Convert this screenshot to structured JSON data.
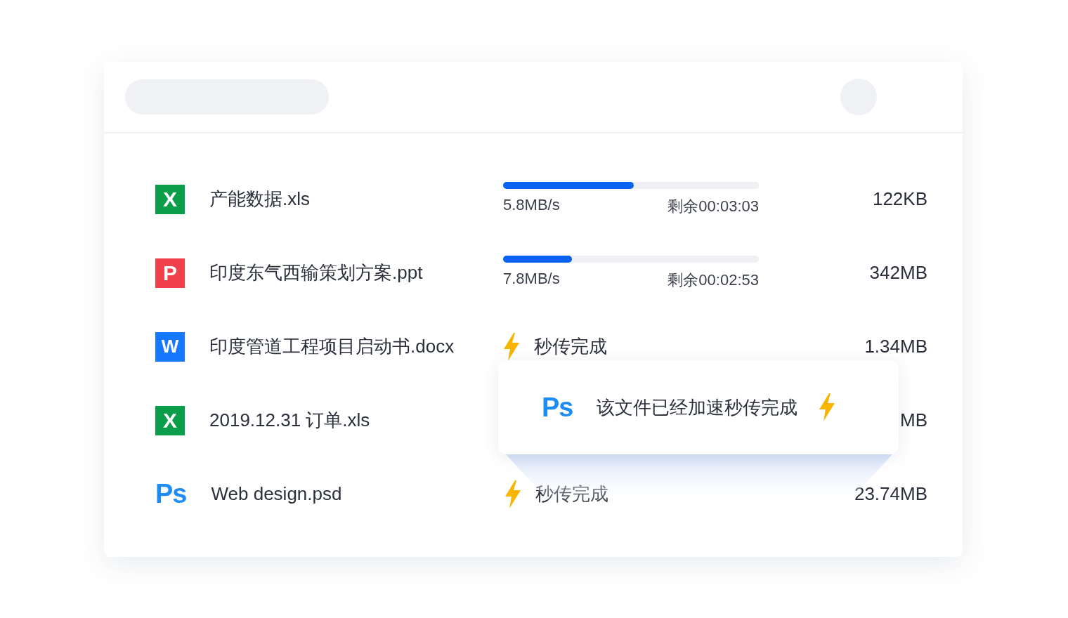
{
  "files": [
    {
      "badge": "X",
      "kind": "xls",
      "name": "产能数据.xls",
      "status": {
        "kind": "progress",
        "level": 0.51,
        "speed": "5.8MB/s",
        "remaining": "剩余00:03:03"
      },
      "size": "122KB"
    },
    {
      "badge": "P",
      "kind": "ppt",
      "name": "印度东气西输策划方案.ppt",
      "status": {
        "kind": "progress",
        "level": 0.27,
        "speed": "7.8MB/s",
        "remaining": "剩余00:02:53"
      },
      "size": "342MB"
    },
    {
      "badge": "W",
      "kind": "doc",
      "name": "印度管道工程项目启动书.docx",
      "status": {
        "kind": "instant",
        "text": "秒传完成"
      },
      "size": "1.34MB"
    },
    {
      "badge": "X",
      "kind": "xls",
      "name": "2019.12.31 订单.xls",
      "size": "MB"
    },
    {
      "badge": "Ps",
      "kind": "psd",
      "name": "Web design.psd",
      "status": {
        "kind": "instant",
        "text": "秒传完成"
      },
      "size": "23.74MB"
    }
  ],
  "toast": {
    "badge": "Ps",
    "message": "该文件已经加速秒传完成"
  }
}
